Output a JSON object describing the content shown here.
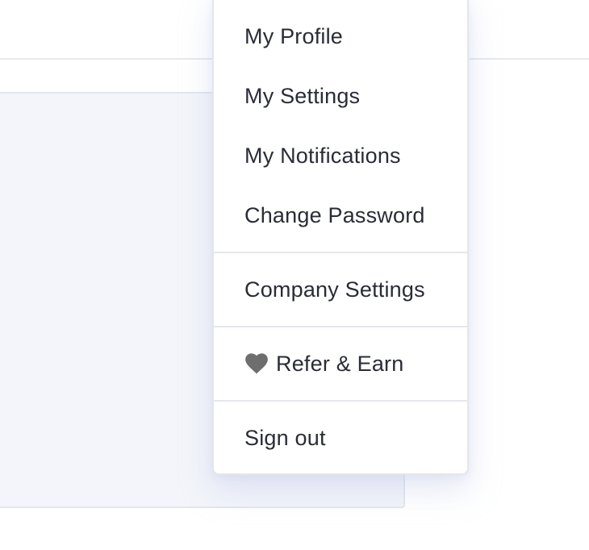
{
  "menu": {
    "group_profile": [
      {
        "label": "My Profile"
      },
      {
        "label": "My Settings"
      },
      {
        "label": "My Notifications"
      },
      {
        "label": "Change Password"
      }
    ],
    "company_settings": {
      "label": "Company Settings"
    },
    "refer_earn": {
      "label": "Refer & Earn",
      "icon": "heart-icon"
    },
    "sign_out": {
      "label": "Sign out"
    }
  },
  "colors": {
    "text": "#2a2c36",
    "icon": "#6e6e6e",
    "divider": "#e6e7ec",
    "panel_bg": "#f3f5fa"
  }
}
